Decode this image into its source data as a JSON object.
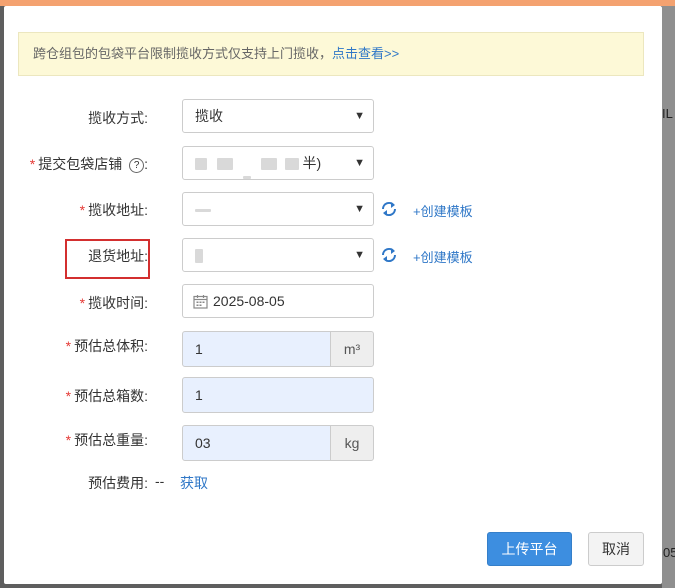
{
  "notice": {
    "text": "跨仓组包的包袋平台限制揽收方式仅支持上门揽收，",
    "link": "点击查看>>"
  },
  "form": {
    "pickup_method": {
      "label": "揽收方式:",
      "value": "揽收"
    },
    "store": {
      "label": "提交包袋店铺",
      "help_icon": "?",
      "colon": ":",
      "value_suffix": "半)"
    },
    "pickup_address": {
      "label": "揽收地址:",
      "create_link": "+创建模板"
    },
    "return_address": {
      "label": "退货地址:",
      "create_link": "+创建模板"
    },
    "pickup_time": {
      "label": "揽收时间:",
      "value": "2025-08-05"
    },
    "volume": {
      "label": "预估总体积:",
      "value": "1",
      "unit": "m³"
    },
    "boxes": {
      "label": "预估总箱数:",
      "value": "1"
    },
    "weight": {
      "label": "预估总重量:",
      "value": "03",
      "unit": "kg"
    },
    "fee": {
      "label": "预估费用:",
      "value": "--",
      "fetch_link": "获取"
    }
  },
  "required_mark": "*",
  "footer": {
    "submit": "上传平台",
    "cancel": "取消"
  },
  "background": {
    "right_text_1": "IL",
    "right_text_2": "05"
  },
  "colors": {
    "primary": "#3d8ee0",
    "link": "#2f77c7",
    "required": "#e53935",
    "highlight": "#d32f2f",
    "notice_bg": "#fdf9d7",
    "input_blue": "#e8f0fe"
  }
}
